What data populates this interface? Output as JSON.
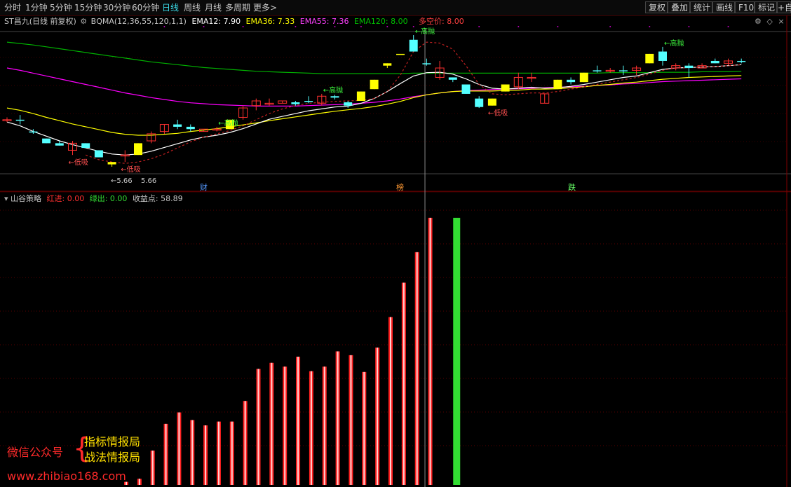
{
  "toolbar": {
    "periods": [
      "分时",
      "1分钟",
      "5分钟",
      "15分钟",
      "30分钟",
      "60分钟",
      "日线",
      "周线",
      "月线",
      "多周期",
      "更多>"
    ],
    "active_index": 6,
    "right_buttons": [
      "复权",
      "叠加",
      "统计",
      "画线",
      "F10",
      "标记",
      "+自"
    ]
  },
  "main_panel": {
    "stock_title": "ST昌九(日线 前复权)",
    "indicator_name": "BQMA(12,36,55,120,1,1)",
    "ema12_label": "EMA12: 7.90",
    "ema36_label": "EMA36: 7.33",
    "ema55_label": "EMA55: 7.36",
    "ema120_label": "EMA120: 8.00",
    "kongjia_label": "多空价: 8.00",
    "low_price_label": "5.66",
    "annotations": {
      "sell": "←高抛",
      "buy": "←低吸",
      "bottom_left": "←5.66"
    },
    "markers": [
      "财",
      "榜",
      "跌"
    ]
  },
  "sub_panel": {
    "name": "山谷策略",
    "red_label": "红进: 0.00",
    "green_label": "绿出: 0.00",
    "profit_label": "收益点: 58.89"
  },
  "watermark": {
    "left": "微信公众号",
    "line1": "指标情报局",
    "line2": "战法情报局",
    "url": "www.zhibiao168.com"
  },
  "colors": {
    "up": "#ff3030",
    "down": "#54ffff",
    "yellow_candle": "#ffff00",
    "ema12": "#ffffff",
    "ema36": "#ffff00",
    "ema55": "#ff00ff",
    "ema120": "#00b000",
    "green_bar": "#33dd33"
  },
  "chart_data": [
    {
      "type": "candlestick",
      "title": "ST昌九(日线 前复权)",
      "candles": [
        {
          "o": 7.35,
          "c": 7.35,
          "h": 7.4,
          "l": 7.3,
          "color": "up"
        },
        {
          "o": 7.35,
          "c": 7.35,
          "h": 7.45,
          "l": 7.25,
          "color": "down"
        },
        {
          "o": 7.1,
          "c": 7.1,
          "h": 7.15,
          "l": 7.05,
          "color": "down"
        },
        {
          "o": 6.95,
          "c": 6.85,
          "h": 6.95,
          "l": 6.85,
          "color": "down"
        },
        {
          "o": 6.85,
          "c": 6.8,
          "h": 6.9,
          "l": 6.8,
          "color": "down"
        },
        {
          "o": 6.85,
          "c": 6.7,
          "h": 6.9,
          "l": 6.6,
          "color": "up"
        },
        {
          "o": 6.85,
          "c": 6.75,
          "h": 6.85,
          "l": 6.75,
          "color": "down"
        },
        {
          "o": 6.7,
          "c": 6.55,
          "h": 6.7,
          "l": 6.55,
          "color": "down"
        },
        {
          "o": 6.4,
          "c": 6.45,
          "h": 6.45,
          "l": 6.35,
          "color": "yellow"
        },
        {
          "o": 6.6,
          "c": 6.6,
          "h": 6.7,
          "l": 6.45,
          "color": "up"
        },
        {
          "o": 6.6,
          "c": 6.85,
          "h": 6.85,
          "l": 6.6,
          "color": "yellow"
        },
        {
          "o": 6.9,
          "c": 7.05,
          "h": 7.1,
          "l": 6.85,
          "color": "up"
        },
        {
          "o": 7.1,
          "c": 7.25,
          "h": 7.25,
          "l": 7.05,
          "color": "up"
        },
        {
          "o": 7.25,
          "c": 7.2,
          "h": 7.35,
          "l": 7.15,
          "color": "down"
        },
        {
          "o": 7.15,
          "c": 7.2,
          "h": 7.25,
          "l": 7.1,
          "color": "down"
        },
        {
          "o": 7.1,
          "c": 7.15,
          "h": 7.15,
          "l": 7.1,
          "color": "up"
        },
        {
          "o": 7.15,
          "c": 7.15,
          "h": 7.2,
          "l": 7.1,
          "color": "up"
        },
        {
          "o": 7.15,
          "c": 7.35,
          "h": 7.35,
          "l": 7.15,
          "color": "yellow"
        },
        {
          "o": 7.4,
          "c": 7.6,
          "h": 7.65,
          "l": 7.35,
          "color": "up"
        },
        {
          "o": 7.65,
          "c": 7.75,
          "h": 7.8,
          "l": 7.55,
          "color": "up"
        },
        {
          "o": 7.7,
          "c": 7.7,
          "h": 7.8,
          "l": 7.65,
          "color": "up"
        },
        {
          "o": 7.7,
          "c": 7.75,
          "h": 7.75,
          "l": 7.7,
          "color": "up"
        },
        {
          "o": 7.72,
          "c": 7.68,
          "h": 7.75,
          "l": 7.65,
          "color": "down"
        },
        {
          "o": 7.75,
          "c": 7.75,
          "h": 7.85,
          "l": 7.7,
          "color": "down"
        },
        {
          "o": 7.7,
          "c": 7.85,
          "h": 7.9,
          "l": 7.65,
          "color": "up"
        },
        {
          "o": 7.85,
          "c": 7.82,
          "h": 7.88,
          "l": 7.78,
          "color": "down"
        },
        {
          "o": 7.72,
          "c": 7.65,
          "h": 7.75,
          "l": 7.6,
          "color": "down"
        },
        {
          "o": 7.75,
          "c": 7.95,
          "h": 7.95,
          "l": 7.75,
          "color": "yellow"
        },
        {
          "o": 8.0,
          "c": 8.2,
          "h": 8.2,
          "l": 8.0,
          "color": "yellow"
        },
        {
          "o": 8.5,
          "c": 8.55,
          "h": 8.55,
          "l": 8.45,
          "color": "yellow"
        },
        {
          "o": 8.75,
          "c": 8.75,
          "h": 8.75,
          "l": 8.75,
          "color": "yellow"
        },
        {
          "o": 9.05,
          "c": 8.8,
          "h": 9.15,
          "l": 8.8,
          "color": "down"
        },
        {
          "o": 8.55,
          "c": 8.55,
          "h": 8.65,
          "l": 8.5,
          "color": "down"
        },
        {
          "o": 8.45,
          "c": 8.25,
          "h": 8.6,
          "l": 8.2,
          "color": "up"
        },
        {
          "o": 8.25,
          "c": 8.2,
          "h": 8.25,
          "l": 8.15,
          "color": "down"
        },
        {
          "o": 8.1,
          "c": 7.9,
          "h": 8.1,
          "l": 7.9,
          "color": "down"
        },
        {
          "o": 7.8,
          "c": 7.62,
          "h": 7.85,
          "l": 7.6,
          "color": "down"
        },
        {
          "o": 7.65,
          "c": 7.8,
          "h": 7.8,
          "l": 7.65,
          "color": "yellow"
        },
        {
          "o": 7.95,
          "c": 8.1,
          "h": 8.1,
          "l": 7.95,
          "color": "yellow"
        },
        {
          "o": 8.05,
          "c": 8.25,
          "h": 8.35,
          "l": 8.0,
          "color": "up"
        },
        {
          "o": 8.25,
          "c": 8.25,
          "h": 8.35,
          "l": 8.15,
          "color": "up"
        },
        {
          "o": 7.9,
          "c": 7.7,
          "h": 7.9,
          "l": 7.7,
          "color": "up"
        },
        {
          "o": 8.0,
          "c": 8.2,
          "h": 8.2,
          "l": 8.0,
          "color": "yellow"
        },
        {
          "o": 8.2,
          "c": 8.15,
          "h": 8.25,
          "l": 8.1,
          "color": "down"
        },
        {
          "o": 8.15,
          "c": 8.35,
          "h": 8.35,
          "l": 8.15,
          "color": "yellow"
        },
        {
          "o": 8.4,
          "c": 8.4,
          "h": 8.5,
          "l": 8.35,
          "color": "down"
        },
        {
          "o": 8.4,
          "c": 8.4,
          "h": 8.45,
          "l": 8.35,
          "color": "up"
        },
        {
          "o": 8.4,
          "c": 8.4,
          "h": 8.5,
          "l": 8.3,
          "color": "down"
        },
        {
          "o": 8.45,
          "c": 8.4,
          "h": 8.5,
          "l": 8.3,
          "color": "up"
        },
        {
          "o": 8.55,
          "c": 8.75,
          "h": 8.75,
          "l": 8.55,
          "color": "yellow"
        },
        {
          "o": 8.8,
          "c": 8.6,
          "h": 8.9,
          "l": 8.5,
          "color": "down"
        },
        {
          "o": 8.45,
          "c": 8.5,
          "h": 8.55,
          "l": 8.4,
          "color": "up"
        },
        {
          "o": 8.5,
          "c": 8.45,
          "h": 8.55,
          "l": 8.25,
          "color": "down"
        },
        {
          "o": 8.45,
          "c": 8.5,
          "h": 8.55,
          "l": 8.45,
          "color": "up"
        },
        {
          "o": 8.6,
          "c": 8.55,
          "h": 8.65,
          "l": 8.55,
          "color": "down"
        },
        {
          "o": 8.55,
          "c": 8.6,
          "h": 8.65,
          "l": 8.5,
          "color": "up"
        },
        {
          "o": 8.6,
          "c": 8.6,
          "h": 8.65,
          "l": 8.55,
          "color": "down"
        }
      ],
      "ema12": [
        7.3,
        7.22,
        7.1,
        7.0,
        6.9,
        6.82,
        6.75,
        6.68,
        6.62,
        6.6,
        6.62,
        6.68,
        6.76,
        6.84,
        6.92,
        6.98,
        7.02,
        7.08,
        7.16,
        7.26,
        7.36,
        7.42,
        7.48,
        7.54,
        7.58,
        7.62,
        7.64,
        7.7,
        7.8,
        7.95,
        8.12,
        8.28,
        8.35,
        8.36,
        8.32,
        8.22,
        8.1,
        8.02,
        8.0,
        8.02,
        8.04,
        8.02,
        8.03,
        8.06,
        8.1,
        8.15,
        8.2,
        8.25,
        8.28,
        8.35,
        8.42,
        8.45,
        8.46,
        8.47,
        8.48,
        8.5,
        8.52
      ],
      "ema36": [
        7.6,
        7.55,
        7.48,
        7.4,
        7.33,
        7.26,
        7.2,
        7.14,
        7.08,
        7.04,
        7.02,
        7.02,
        7.04,
        7.06,
        7.1,
        7.13,
        7.16,
        7.2,
        7.24,
        7.28,
        7.33,
        7.37,
        7.41,
        7.45,
        7.49,
        7.53,
        7.56,
        7.59,
        7.63,
        7.68,
        7.74,
        7.82,
        7.88,
        7.92,
        7.95,
        7.96,
        7.96,
        7.96,
        7.97,
        7.98,
        8.0,
        8.0,
        8.01,
        8.03,
        8.05,
        8.08,
        8.1,
        8.13,
        8.15,
        8.18,
        8.21,
        8.23,
        8.25,
        8.26,
        8.27,
        8.28,
        8.29
      ],
      "ema55": [
        8.45,
        8.4,
        8.34,
        8.28,
        8.22,
        8.16,
        8.1,
        8.04,
        7.98,
        7.92,
        7.87,
        7.82,
        7.78,
        7.74,
        7.71,
        7.69,
        7.67,
        7.66,
        7.65,
        7.64,
        7.64,
        7.64,
        7.64,
        7.65,
        7.66,
        7.67,
        7.68,
        7.7,
        7.72,
        7.75,
        7.79,
        7.84,
        7.88,
        7.92,
        7.95,
        7.97,
        7.98,
        7.99,
        8.0,
        8.01,
        8.02,
        8.03,
        8.04,
        8.05,
        8.06,
        8.08,
        8.09,
        8.11,
        8.12,
        8.14,
        8.16,
        8.17,
        8.18,
        8.19,
        8.2,
        8.21,
        8.22
      ],
      "ema120": [
        9.0,
        8.97,
        8.94,
        8.9,
        8.86,
        8.82,
        8.78,
        8.74,
        8.7,
        8.66,
        8.62,
        8.58,
        8.55,
        8.52,
        8.49,
        8.46,
        8.44,
        8.42,
        8.4,
        8.38,
        8.37,
        8.36,
        8.35,
        8.34,
        8.33,
        8.33,
        8.33,
        8.33,
        8.33,
        8.33,
        8.33,
        8.34,
        8.34,
        8.34,
        8.34,
        8.34,
        8.34,
        8.34,
        8.34,
        8.34,
        8.34,
        8.34,
        8.34,
        8.34,
        8.34,
        8.34,
        8.35,
        8.35,
        8.35,
        8.35,
        8.36,
        8.36,
        8.36,
        8.37,
        8.37,
        8.37,
        8.38
      ],
      "kongjia": [
        null,
        null,
        null,
        null,
        null,
        null,
        6.6,
        6.5,
        6.45,
        6.42,
        6.45,
        6.52,
        6.62,
        6.75,
        6.88,
        6.98,
        7.05,
        7.12,
        7.22,
        7.35,
        7.48,
        7.58,
        7.65,
        7.7,
        7.72,
        7.74,
        7.75,
        7.76,
        7.8,
        7.95,
        8.3,
        8.8,
        9.0,
        8.98,
        8.85,
        8.5,
        8.1,
        7.9,
        7.88,
        7.9,
        7.92,
        7.92,
        7.95,
        8.0,
        8.05,
        8.1,
        8.15,
        8.2,
        8.25,
        8.32,
        8.4,
        8.45,
        8.46,
        8.47,
        8.48,
        8.5,
        8.52
      ],
      "ylim": [
        6.2,
        9.3
      ]
    },
    {
      "type": "bar",
      "title": "山谷策略",
      "values": [
        0.4,
        0.8,
        4.5,
        8.0,
        9.5,
        8.5,
        7.8,
        8.3,
        8.3,
        11.0,
        15.2,
        16.0,
        15.5,
        16.8,
        14.9,
        15.5,
        17.5,
        17.0,
        14.8,
        18.0,
        22.0,
        26.5,
        30.5,
        35.0,
        0,
        35.0
      ],
      "colors": [
        "red",
        "red",
        "red",
        "red",
        "red",
        "red",
        "red",
        "red",
        "red",
        "red",
        "red",
        "red",
        "red",
        "red",
        "red",
        "red",
        "red",
        "red",
        "red",
        "red",
        "red",
        "red",
        "red",
        "red",
        "none",
        "green"
      ],
      "ylim": [
        0,
        36
      ]
    }
  ]
}
